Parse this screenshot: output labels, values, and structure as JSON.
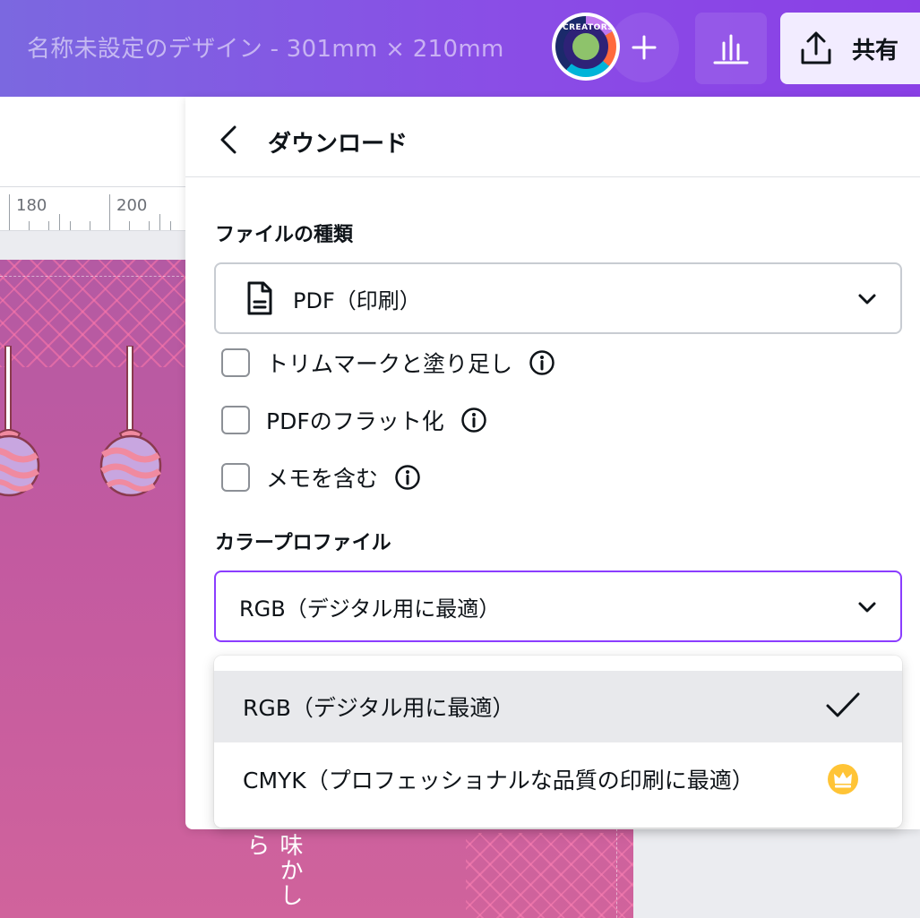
{
  "header": {
    "doc_title": "名称未設定のデザイン - 301mm × 210mm",
    "avatar_label": "CREATORS",
    "share_label": "共有"
  },
  "ruler": {
    "labels": [
      "180",
      "200"
    ]
  },
  "design": {
    "vertical_text": "味かしら"
  },
  "panel": {
    "title": "ダウンロード",
    "file_type_label": "ファイルの種類",
    "file_type_value": "PDF（印刷）",
    "options": [
      {
        "label": "トリムマークと塗り足し",
        "checked": false
      },
      {
        "label": "PDFのフラット化",
        "checked": false
      },
      {
        "label": "メモを含む",
        "checked": false
      }
    ],
    "color_profile_label": "カラープロファイル",
    "color_profile_value": "RGB（デジタル用に最適）"
  },
  "dropdown": {
    "items": [
      {
        "label": "RGB（デジタル用に最適）",
        "selected": true
      },
      {
        "label": "CMYK（プロフェッショナルな品質の印刷に最適）",
        "selected": false,
        "premium": true
      }
    ]
  },
  "colors": {
    "accent": "#8b3dff",
    "premium": "#ffc436",
    "topbar_start": "#7b68e0",
    "topbar_end": "#8a3fe6"
  }
}
